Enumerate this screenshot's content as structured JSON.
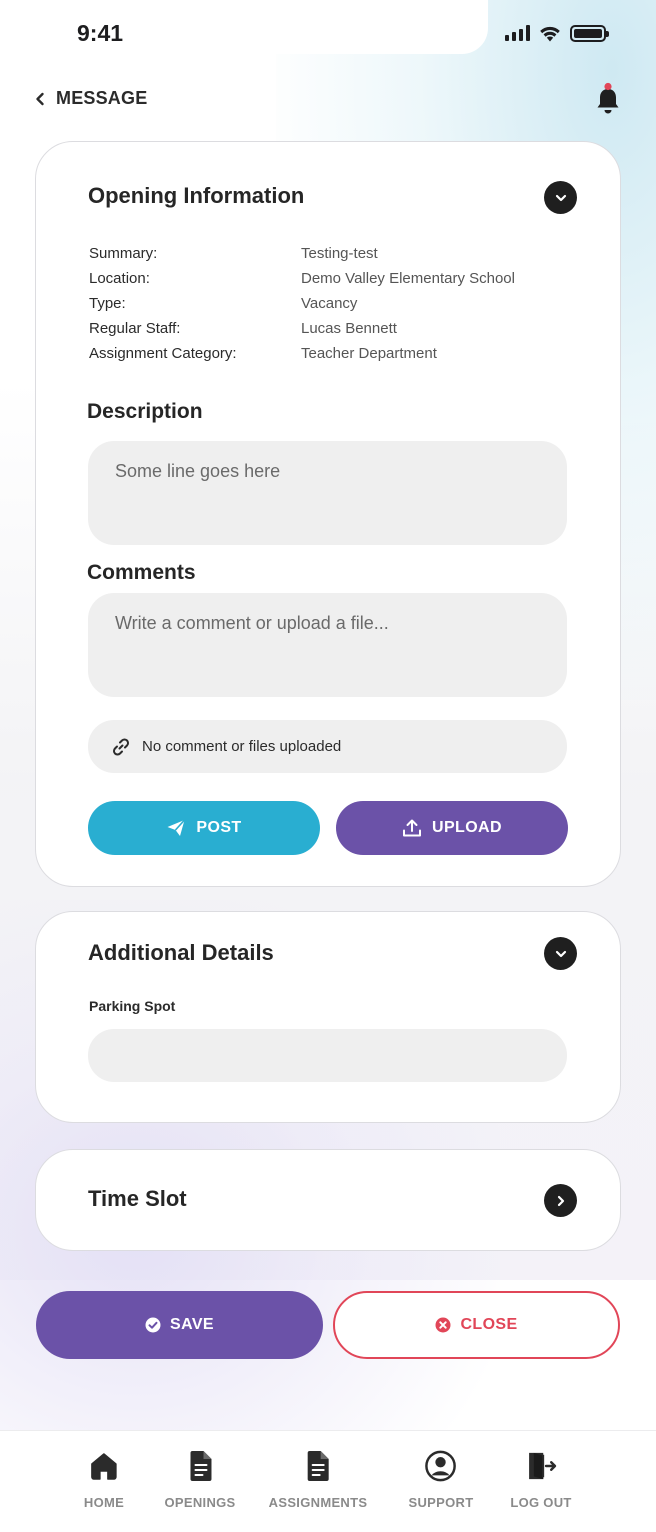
{
  "status_bar": {
    "time": "9:41"
  },
  "header": {
    "back_label": "MESSAGE"
  },
  "opening_information": {
    "title": "Opening Information",
    "rows": [
      {
        "key": "Summary:",
        "value": "Testing-test"
      },
      {
        "key": "Location:",
        "value": "Demo Valley Elementary School"
      },
      {
        "key": "Type:",
        "value": "Vacancy"
      },
      {
        "key": "Regular Staff:",
        "value": "Lucas Bennett"
      },
      {
        "key": "Assignment Category:",
        "value": "Teacher Department"
      }
    ],
    "description": {
      "label": "Description",
      "placeholder": "Some line goes here"
    },
    "comments": {
      "label": "Comments",
      "placeholder": "Write a comment or upload a file...",
      "files_status": "No comment or files uploaded"
    },
    "post_label": "POST",
    "upload_label": "UPLOAD"
  },
  "additional_details": {
    "title": "Additional Details",
    "parking_label": "Parking Spot",
    "parking_value": ""
  },
  "time_slot": {
    "title": "Time Slot"
  },
  "actions": {
    "save_label": "SAVE",
    "close_label": "CLOSE"
  },
  "bottom_nav": {
    "items": [
      {
        "label": "HOME",
        "icon": "home-icon"
      },
      {
        "label": "OPENINGS",
        "icon": "document-icon"
      },
      {
        "label": "ASSIGNMENTS",
        "icon": "document-icon"
      },
      {
        "label": "SUPPORT",
        "icon": "user-circle-icon"
      },
      {
        "label": "LOG OUT",
        "icon": "logout-icon"
      }
    ]
  },
  "colors": {
    "primary_purple": "#6b52a8",
    "accent_cyan": "#29aed1",
    "danger_red": "#e14658",
    "notification_dot": "#e14658"
  }
}
